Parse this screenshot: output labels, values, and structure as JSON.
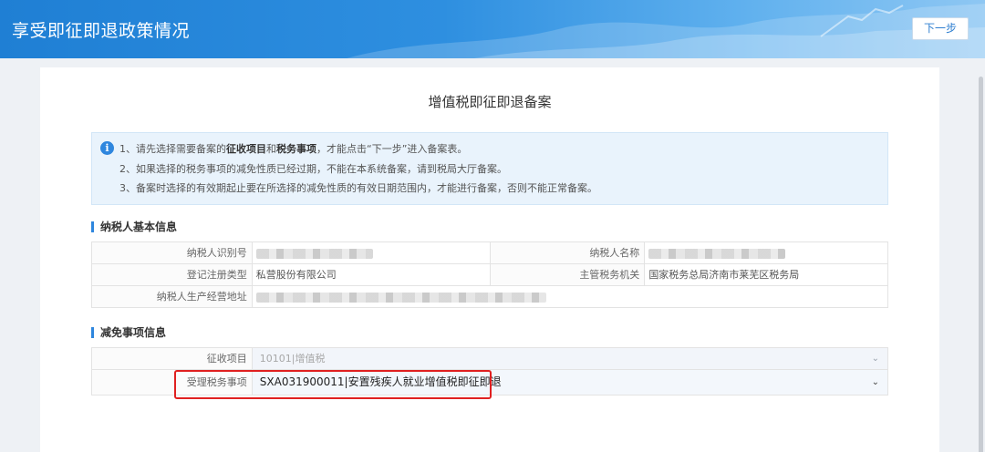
{
  "header": {
    "title": "享受即征即退政策情况",
    "next_label": "下一步"
  },
  "page_title": "增值税即征即退备案",
  "notice": {
    "line1_prefix": "1、请先选择需要备案的",
    "line1_bold1": "征收项目",
    "line1_mid": "和",
    "line1_bold2": "税务事项",
    "line1_suffix": "，才能点击“下一步”进入备案表。",
    "line2": "2、如果选择的税务事项的减免性质已经过期，不能在本系统备案，请到税局大厅备案。",
    "line3": "3、备案时选择的有效期起止要在所选择的减免性质的有效日期范围内，才能进行备案，否则不能正常备案。"
  },
  "taxpayer_section": {
    "heading": "纳税人基本信息",
    "rows": [
      {
        "label1": "纳税人识别号",
        "value1": "",
        "label2": "纳税人名称",
        "value2": ""
      },
      {
        "label1": "登记注册类型",
        "value1": "私营股份有限公司",
        "label2": "主管税务机关",
        "value2": "国家税务总局济南市莱芜区税务局"
      },
      {
        "label1": "纳税人生产经营地址",
        "value1": ""
      }
    ]
  },
  "exemption_section": {
    "heading": "减免事项信息",
    "collection_item_label": "征收项目",
    "collection_item_value": "10101|增值税",
    "tax_matter_label": "受理税务事项",
    "tax_matter_value": "SXA031900011|安置残疾人就业增值税即征即退"
  },
  "colors": {
    "header_blue": "#1f7fd4",
    "accent_blue": "#2e86de",
    "highlight_red": "#e02020"
  }
}
